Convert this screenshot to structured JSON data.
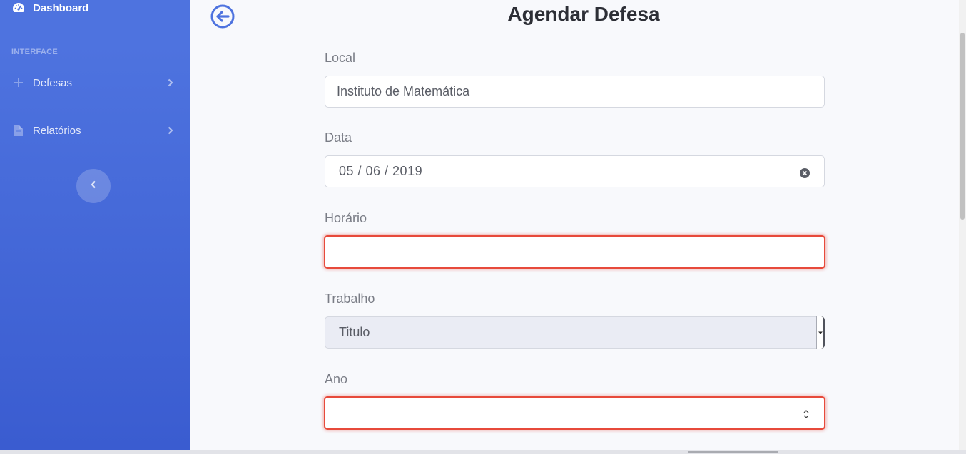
{
  "sidebar": {
    "dashboard_label": "Dashboard",
    "heading": "INTERFACE",
    "items": [
      {
        "label": "Defesas",
        "icon": "plus-icon"
      },
      {
        "label": "Relatórios",
        "icon": "file-icon"
      }
    ],
    "toggle_icon": "chevron-left-icon"
  },
  "page": {
    "title": "Agendar Defesa",
    "back_icon": "arrow-circle-left-icon"
  },
  "form": {
    "local": {
      "label": "Local",
      "value": "Instituto de Matemática"
    },
    "data": {
      "label": "Data",
      "value": "05 / 06 / 2019"
    },
    "horario": {
      "label": "Horário",
      "value": ""
    },
    "trabalho": {
      "label": "Trabalho",
      "value": "Titulo"
    },
    "ano": {
      "label": "Ano",
      "value": ""
    }
  },
  "colors": {
    "sidebar": "#4e73df",
    "accent": "#4e73df",
    "invalid": "#e74a3b",
    "background": "#f8f9fc"
  }
}
